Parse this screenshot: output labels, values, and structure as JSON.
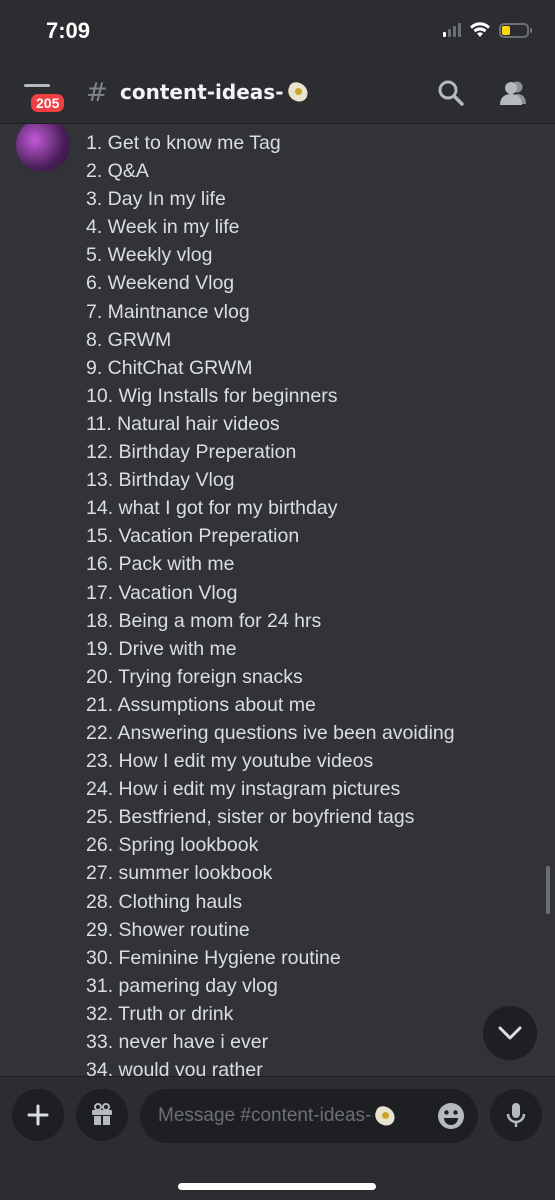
{
  "status_bar": {
    "time": "7:09",
    "battery_level": 0.25
  },
  "header": {
    "unread_badge": "205",
    "channel_hash": "#",
    "channel_name": "content-ideas-",
    "channel_emoji": "flower-emoji"
  },
  "message": {
    "items": [
      "1. Get to know me Tag",
      "2. Q&A",
      "3. Day In my life",
      "4. Week in my life",
      "5. Weekly vlog",
      "6. Weekend Vlog",
      "7. Maintnance vlog",
      "8. GRWM",
      "9. ChitChat GRWM",
      "10. Wig Installs for beginners",
      "11. Natural hair videos",
      "12. Birthday Preperation",
      "13. Birthday Vlog",
      "14. what I got for my birthday",
      "15. Vacation Preperation",
      "16. Pack with me",
      "17. Vacation Vlog",
      "18. Being a mom for 24 hrs",
      "19. Drive with me",
      "20. Trying foreign snacks",
      "21. Assumptions about me",
      "22. Answering questions ive been avoiding",
      "23. How I edit my youtube videos",
      "24. How i edit my instagram pictures",
      "25. Bestfriend, sister or boyfriend tags",
      "26. Spring lookbook",
      "27. summer lookbook",
      "28. Clothing hauls",
      "29. Shower routine",
      "30. Feminine Hygiene routine",
      "31. pamering day vlog",
      "32. Truth or drink",
      "33. never have i ever",
      "34. would you rather"
    ]
  },
  "composer": {
    "placeholder": "Message #content-ideas-"
  },
  "colors": {
    "background": "#313338",
    "header": "#2b2d31",
    "badge": "#f23f43",
    "input": "#1e1f22"
  }
}
